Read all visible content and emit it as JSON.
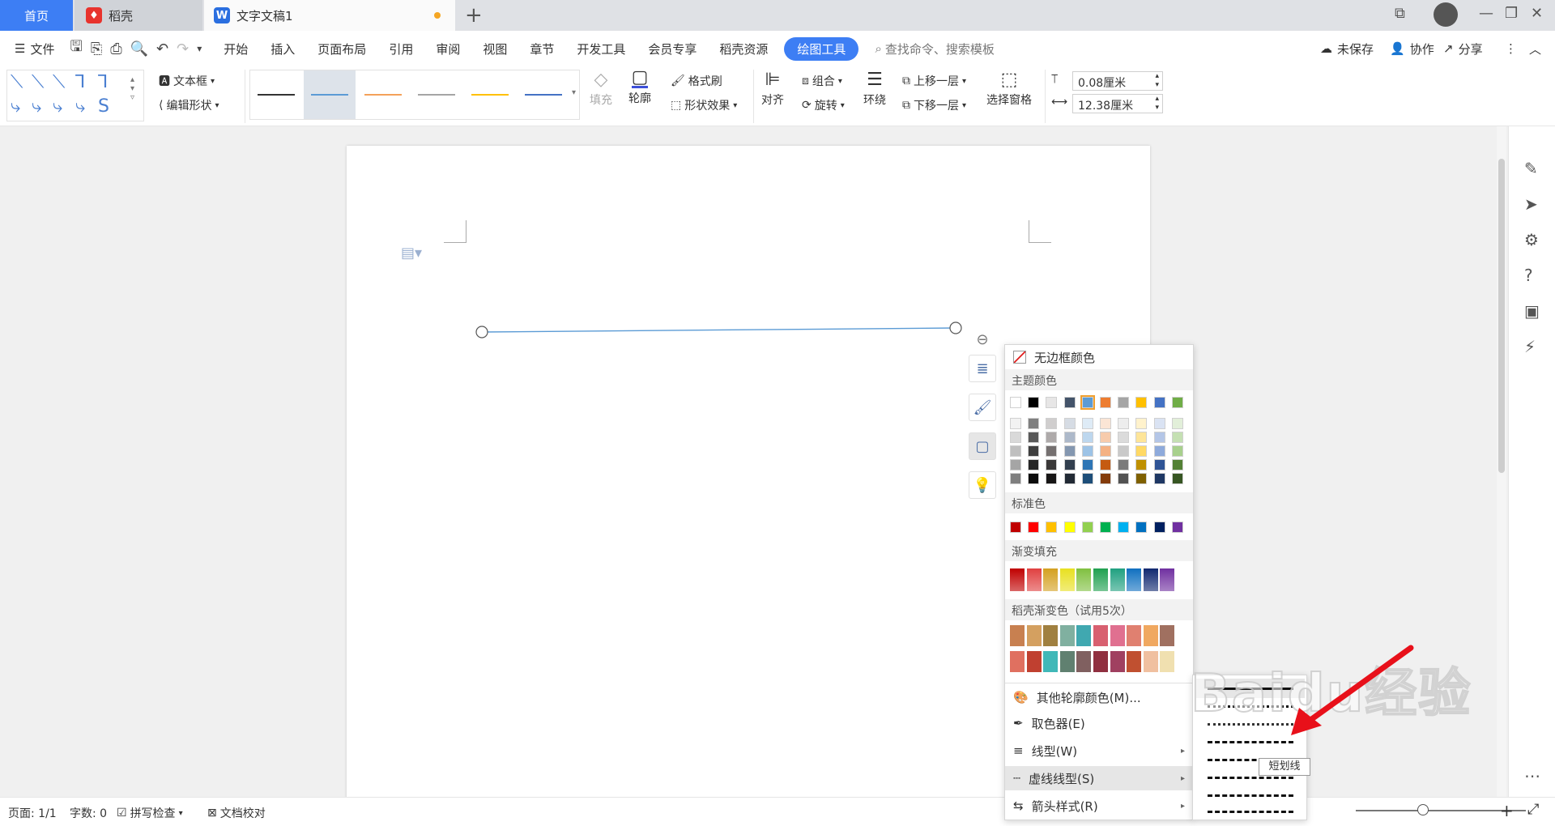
{
  "tabs": {
    "home": "首页",
    "daoke": "稻壳",
    "doc": "文字文稿1"
  },
  "menu": {
    "file": "文件",
    "items": [
      "开始",
      "插入",
      "页面布局",
      "引用",
      "审阅",
      "视图",
      "章节",
      "开发工具",
      "会员专享",
      "稻壳资源"
    ],
    "drawing_tools": "绘图工具",
    "search": "查找命令、搜索模板",
    "unsaved": "未保存",
    "collab": "协作",
    "share": "分享"
  },
  "ribbon": {
    "textbox": "文本框",
    "edit_shape": "编辑形状",
    "fill": "填充",
    "outline": "轮廓",
    "format_painter": "格式刷",
    "shape_effects": "形状效果",
    "align": "对齐",
    "group": "组合",
    "rotate": "旋转",
    "wrap": "环绕",
    "bring_forward": "上移一层",
    "send_backward": "下移一层",
    "selection_pane": "选择窗格",
    "height": "0.08厘米",
    "width": "12.38厘米",
    "line_style_colors": [
      "#333333",
      "#5b9bd5",
      "#f4a15a",
      "#a5a5a5",
      "#ffc000",
      "#4472c4"
    ]
  },
  "color_menu": {
    "no_border": "无边框颜色",
    "theme_colors": "主题颜色",
    "standard_colors": "标准色",
    "gradient_fill": "渐变填充",
    "daoke_gradient": "稻壳渐变色（试用5次）",
    "other_colors": "其他轮廓颜色(M)...",
    "eyedropper": "取色器(E)",
    "line_type": "线型(W)",
    "dash_type": "虚线线型(S)",
    "arrow_style": "箭头样式(R)",
    "theme_top": [
      "#ffffff",
      "#000000",
      "#e7e6e6",
      "#44546a",
      "#5b9bd5",
      "#ed7d31",
      "#a5a5a5",
      "#ffc000",
      "#4472c4",
      "#70ad47"
    ],
    "theme_shades": [
      [
        "#f2f2f2",
        "#7f7f7f",
        "#d0cece",
        "#d6dce4",
        "#deebf6",
        "#fbe5d5",
        "#ededed",
        "#fff2cc",
        "#dae3f3",
        "#e2efd9"
      ],
      [
        "#d9d9d9",
        "#595959",
        "#aeaaaa",
        "#adb9ca",
        "#bdd7ee",
        "#f7cbac",
        "#dbdbdb",
        "#fee599",
        "#b4c6e7",
        "#c5e0b3"
      ],
      [
        "#bfbfbf",
        "#3f3f3f",
        "#757070",
        "#8497b0",
        "#9dc3e6",
        "#f4b183",
        "#c9c9c9",
        "#ffd965",
        "#8eaadb",
        "#a8d08d"
      ],
      [
        "#a5a5a5",
        "#262626",
        "#3a3838",
        "#323f4f",
        "#2e75b5",
        "#c55a11",
        "#7b7b7b",
        "#bf9000",
        "#2f5496",
        "#538135"
      ],
      [
        "#7f7f7f",
        "#0c0c0c",
        "#171616",
        "#222a35",
        "#1e4e79",
        "#843c0b",
        "#525252",
        "#7f6000",
        "#1f3864",
        "#375623"
      ]
    ],
    "standard": [
      "#c00000",
      "#ff0000",
      "#ffc000",
      "#ffff00",
      "#92d050",
      "#00b050",
      "#00b0f0",
      "#0070c0",
      "#002060",
      "#7030a0"
    ],
    "gradients": [
      "#c00000",
      "#e04040",
      "#d4a020",
      "#e8e020",
      "#80c040",
      "#20a050",
      "#20a080",
      "#1070c0",
      "#102870",
      "#7030a0"
    ],
    "daoke_row1": [
      "#c88050",
      "#d4a060",
      "#a08040",
      "#80b0a0",
      "#40a8b0",
      "#d86070",
      "#e07090",
      "#e08070",
      "#f0a860",
      "#a07060"
    ],
    "daoke_row2": [
      "#e07060",
      "#c04030",
      "#40b8b8",
      "#608070",
      "#806060",
      "#903040",
      "#a04060",
      "#c05030",
      "#f0c0a0",
      "#f0e0b0"
    ]
  },
  "dash_submenu": {
    "tooltip": "短划线",
    "patterns": [
      "solid",
      "dotted-round",
      "dotted-square",
      "dash",
      "dash-dot",
      "long-dash",
      "long-dash-dot",
      "long-dash-dot-dot"
    ]
  },
  "status": {
    "page": "页面: 1/1",
    "words": "字数: 0",
    "spell": "拼写检查",
    "proof": "文档校对"
  },
  "watermark": "Baidu经验"
}
